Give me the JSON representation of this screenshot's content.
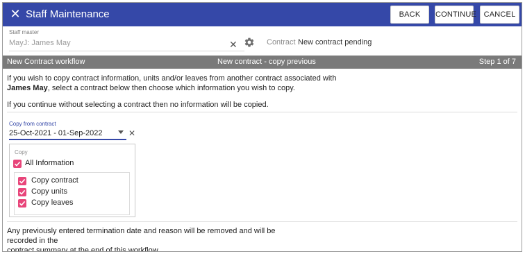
{
  "header": {
    "title": "Staff Maintenance",
    "back_label": "BACK",
    "continue_label": "CONTINUE",
    "cancel_label": "CANCEL"
  },
  "staff_master": {
    "label": "Staff master",
    "value": "MayJ: James May"
  },
  "contract": {
    "label": "Contract",
    "value": "New contract pending"
  },
  "workflow_bar": {
    "left": "New Contract workflow",
    "center": "New contract - copy previous",
    "right": "Step 1 of 7"
  },
  "intro": {
    "line1": "If you wish to copy contract information, units and/or leaves from another contract associated with",
    "name": "James May",
    "line2_rest": ", select a contract below then choose which information you wish to copy.",
    "note": "If you continue without selecting a contract then no information will be copied."
  },
  "copy_from": {
    "label": "Copy from contract",
    "value": "25-Oct-2021 - 01-Sep-2022"
  },
  "copy_options": {
    "legend": "Copy",
    "all_label": "All Information",
    "items": [
      {
        "label": "Copy contract",
        "checked": true
      },
      {
        "label": "Copy units",
        "checked": true
      },
      {
        "label": "Copy leaves",
        "checked": true
      }
    ]
  },
  "footer_note": {
    "line1": "Any previously entered termination date and reason will be removed and will be recorded in the",
    "line2": "contract summary at the end of this workflow."
  },
  "colors": {
    "header_bg": "#3548a8",
    "checkbox": "#e8457a",
    "workflow_bar": "#7a7a7a"
  }
}
